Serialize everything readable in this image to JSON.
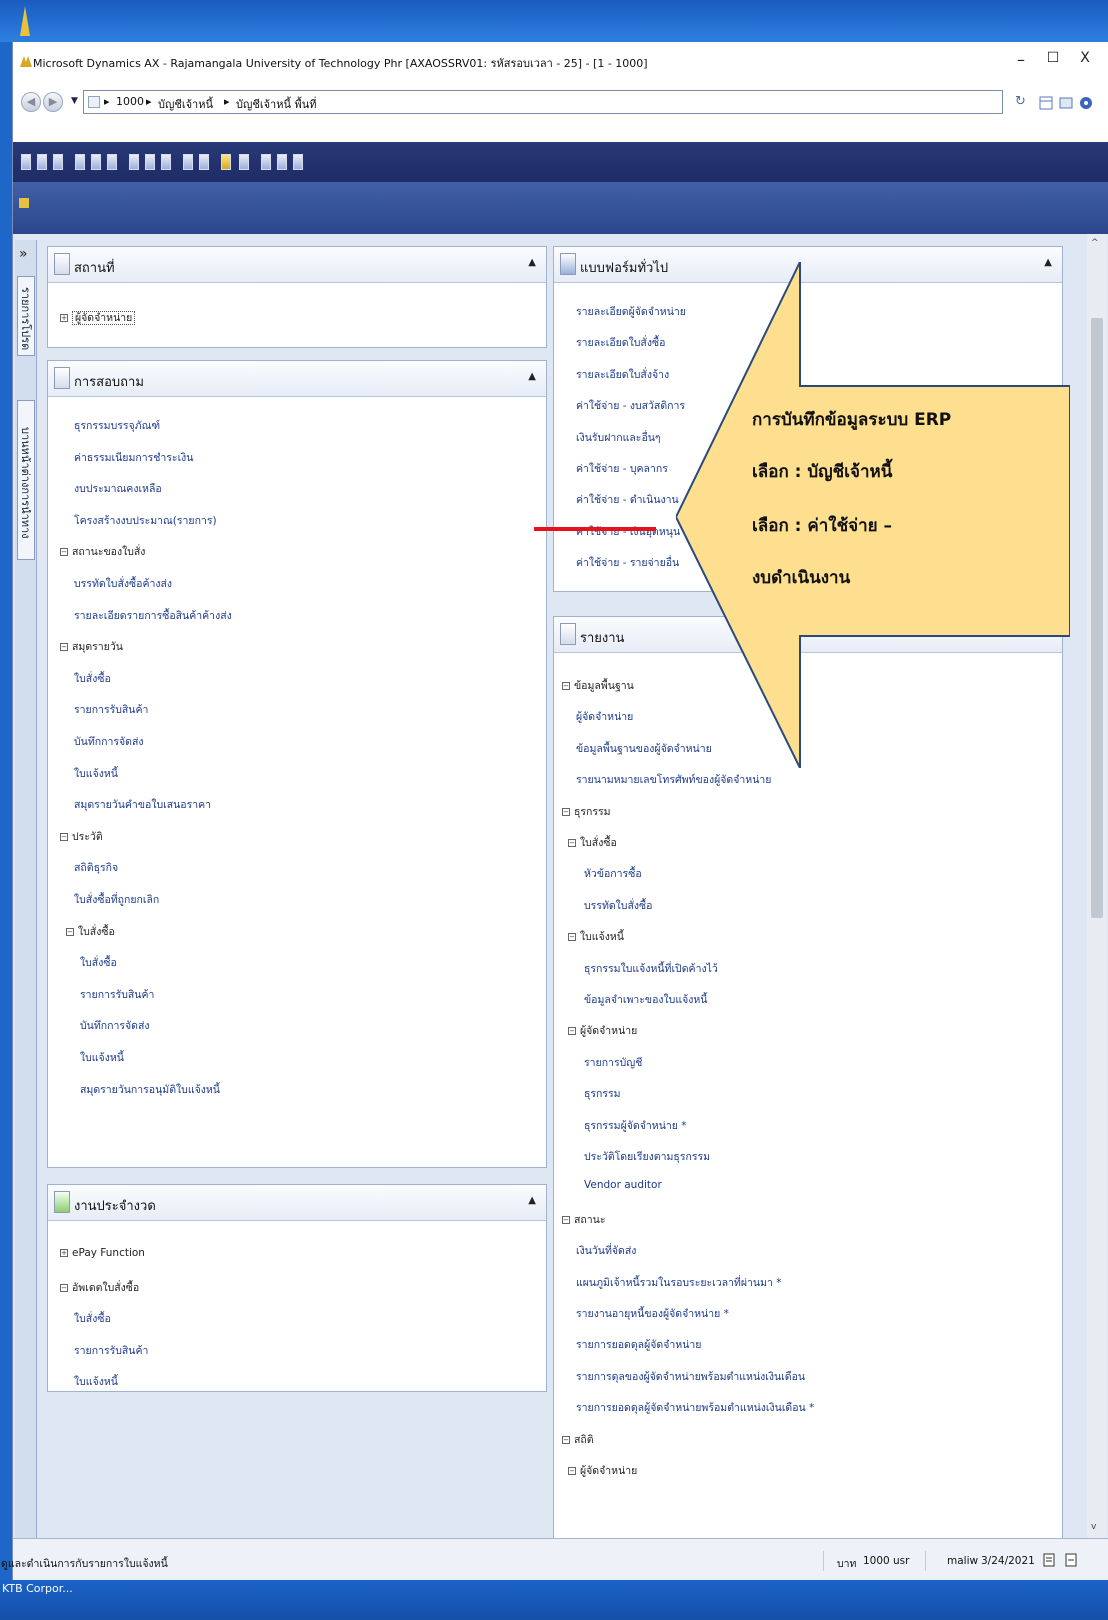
{
  "window": {
    "title": "Microsoft Dynamics AX - Rajamangala University of Technology Phr [AXAOSSRV01: รหัสรอบเวลา - 25] - [1 - 1000]",
    "minimize": "–",
    "maximize": "☐",
    "close": "X"
  },
  "address": {
    "back": "◀",
    "forward": "▶",
    "dropdown": "▼",
    "separator": "▸",
    "crumbs": [
      "1000",
      "บัญชีเจ้าหนี้",
      "บัญชีเจ้าหนี้ พื้นที่"
    ],
    "refresh": "↻"
  },
  "navpane": {
    "expand": "»",
    "tabs": [
      "รายการโปรด",
      "บานหน้าต่างการนำทาง"
    ]
  },
  "panels": {
    "places": {
      "title": "สถานที่",
      "items": [
        {
          "label": "ผู้จัดจำหน่าย",
          "toggle": "+"
        }
      ]
    },
    "inquiries": {
      "title": "การสอบถาม",
      "items": [
        {
          "label": "ธุรกรรมบรรจุภัณฑ์",
          "type": "item"
        },
        {
          "label": "ค่าธรรมเนียมการชำระเงิน",
          "type": "item"
        },
        {
          "label": "งบประมาณคงเหลือ",
          "type": "item"
        },
        {
          "label": "โครงสร้างงบประมาณ(รายการ)",
          "type": "item"
        },
        {
          "label": "สถานะของใบสั่ง",
          "type": "group",
          "toggle": "−"
        },
        {
          "label": "บรรทัดใบสั่งซื้อค้างส่ง",
          "type": "item"
        },
        {
          "label": "รายละเอียดรายการซื้อสินค้าค้างส่ง",
          "type": "item"
        },
        {
          "label": "สมุดรายวัน",
          "type": "group",
          "toggle": "−"
        },
        {
          "label": "ใบสั่งซื้อ",
          "type": "item"
        },
        {
          "label": "รายการรับสินค้า",
          "type": "item"
        },
        {
          "label": "บันทึกการจัดส่ง",
          "type": "item"
        },
        {
          "label": "ใบแจ้งหนี้",
          "type": "item"
        },
        {
          "label": "สมุดรายวันคำขอใบเสนอราคา",
          "type": "item"
        },
        {
          "label": "ประวัติ",
          "type": "group",
          "toggle": "−"
        },
        {
          "label": "สถิติธุรกิจ",
          "type": "item"
        },
        {
          "label": "ใบสั่งซื้อที่ถูกยกเลิก",
          "type": "item"
        },
        {
          "label": "ใบสั่งซื้อ",
          "type": "group",
          "toggle": "−"
        },
        {
          "label": "ใบสั่งซื้อ",
          "type": "item"
        },
        {
          "label": "รายการรับสินค้า",
          "type": "item"
        },
        {
          "label": "บันทึกการจัดส่ง",
          "type": "item"
        },
        {
          "label": "ใบแจ้งหนี้",
          "type": "item"
        },
        {
          "label": "สมุดรายวันการอนุมัติใบแจ้งหนี้",
          "type": "item"
        }
      ]
    },
    "periodic": {
      "title": "งานประจำงวด",
      "items": [
        {
          "label": "ePay Function",
          "type": "group",
          "toggle": "+"
        },
        {
          "label": "อัพเดตใบสั่งซื้อ",
          "type": "group",
          "toggle": "−"
        },
        {
          "label": "ใบสั่งซื้อ",
          "type": "item"
        },
        {
          "label": "รายการรับสินค้า",
          "type": "item"
        },
        {
          "label": "ใบแจ้งหนี้",
          "type": "item"
        }
      ]
    },
    "forms": {
      "title": "แบบฟอร์มทั่วไป",
      "items": [
        "รายละเอียดผู้จัดจำหน่าย",
        "รายละเอียดใบสั่งซื้อ",
        "รายละเอียดใบสั่งจ้าง",
        "ค่าใช้จ่าย - งบสวัสดิการ",
        "เงินรับฝากและอื่นๆ",
        "ค่าใช้จ่าย - บุคลากร",
        "ค่าใช้จ่าย - ดำเนินงาน",
        "ค่าใช้จ่าย - เงินอุดหนุน",
        "ค่าใช้จ่าย - รายจ่ายอื่น"
      ]
    },
    "reports": {
      "title": "รายงาน",
      "items": [
        {
          "label": "ข้อมูลพื้นฐาน",
          "type": "group",
          "toggle": "−"
        },
        {
          "label": "ผู้จัดจำหน่าย",
          "type": "item"
        },
        {
          "label": "ข้อมูลพื้นฐานของผู้จัดจำหน่าย",
          "type": "item"
        },
        {
          "label": "รายนามหมายเลขโทรศัพท์ของผู้จัดจำหน่าย",
          "type": "item"
        },
        {
          "label": "ธุรกรรม",
          "type": "group",
          "toggle": "−"
        },
        {
          "label": "ใบสั่งซื้อ",
          "type": "group",
          "toggle": "−"
        },
        {
          "label": "หัวข้อการซื้อ",
          "type": "item"
        },
        {
          "label": "บรรทัดใบสั่งซื้อ",
          "type": "item"
        },
        {
          "label": "ใบแจ้งหนี้",
          "type": "group",
          "toggle": "−"
        },
        {
          "label": "ธุรกรรมใบแจ้งหนี้ที่เปิดค้างไว้",
          "type": "item"
        },
        {
          "label": "ข้อมูลจำเพาะของใบแจ้งหนี้",
          "type": "item"
        },
        {
          "label": "ผู้จัดจำหน่าย",
          "type": "group",
          "toggle": "−"
        },
        {
          "label": "รายการบัญชี",
          "type": "item"
        },
        {
          "label": "ธุรกรรม",
          "type": "item"
        },
        {
          "label": "ธุรกรรมผู้จัดจำหน่าย *",
          "type": "item"
        },
        {
          "label": "ประวัติโดยเรียงตามธุรกรรม",
          "type": "item"
        },
        {
          "label": "Vendor auditor",
          "type": "item"
        },
        {
          "label": "สถานะ",
          "type": "group",
          "toggle": "−"
        },
        {
          "label": "เงินวันที่จัดส่ง",
          "type": "item"
        },
        {
          "label": "แผนภูมิเจ้าหนี้รวมในรอบระยะเวลาที่ผ่านมา *",
          "type": "item"
        },
        {
          "label": "รายงานอายุหนี้ของผู้จัดจำหน่าย *",
          "type": "item"
        },
        {
          "label": "รายการยอดดุลผู้จัดจำหน่าย",
          "type": "item"
        },
        {
          "label": "รายการดุลของผู้จัดจำหน่ายพร้อมตำแหน่งเงินเดือน",
          "type": "item"
        },
        {
          "label": "รายการยอดดุลผู้จัดจำหน่ายพร้อมตำแหน่งเงินเดือน *",
          "type": "item"
        },
        {
          "label": "สถิติ",
          "type": "group",
          "toggle": "−"
        },
        {
          "label": "ผู้จัดจำหน่าย",
          "type": "group",
          "toggle": "−"
        }
      ]
    }
  },
  "callout": {
    "line1": "การบันทึกข้อมูลระบบ ERP",
    "line2": "เลือก : บัญชีเจ้าหนี้",
    "line3": "เลือก :  ค่าใช้จ่าย –",
    "line4": "งบดำเนินงาน",
    "fill": "#fddf8f",
    "stroke": "#2b4a7c",
    "marker_color": "#e8121e"
  },
  "statusbar": {
    "message": "ดูและดำเนินการกับรายการใบแจ้งหนี้",
    "currency": "บาท",
    "company": "1000",
    "layer": "usr",
    "user": "maliw",
    "date": "3/24/2021"
  },
  "taskbar": {
    "label": "KTB Corpor..."
  },
  "scrollbar": {
    "up": "^",
    "down": "v"
  }
}
